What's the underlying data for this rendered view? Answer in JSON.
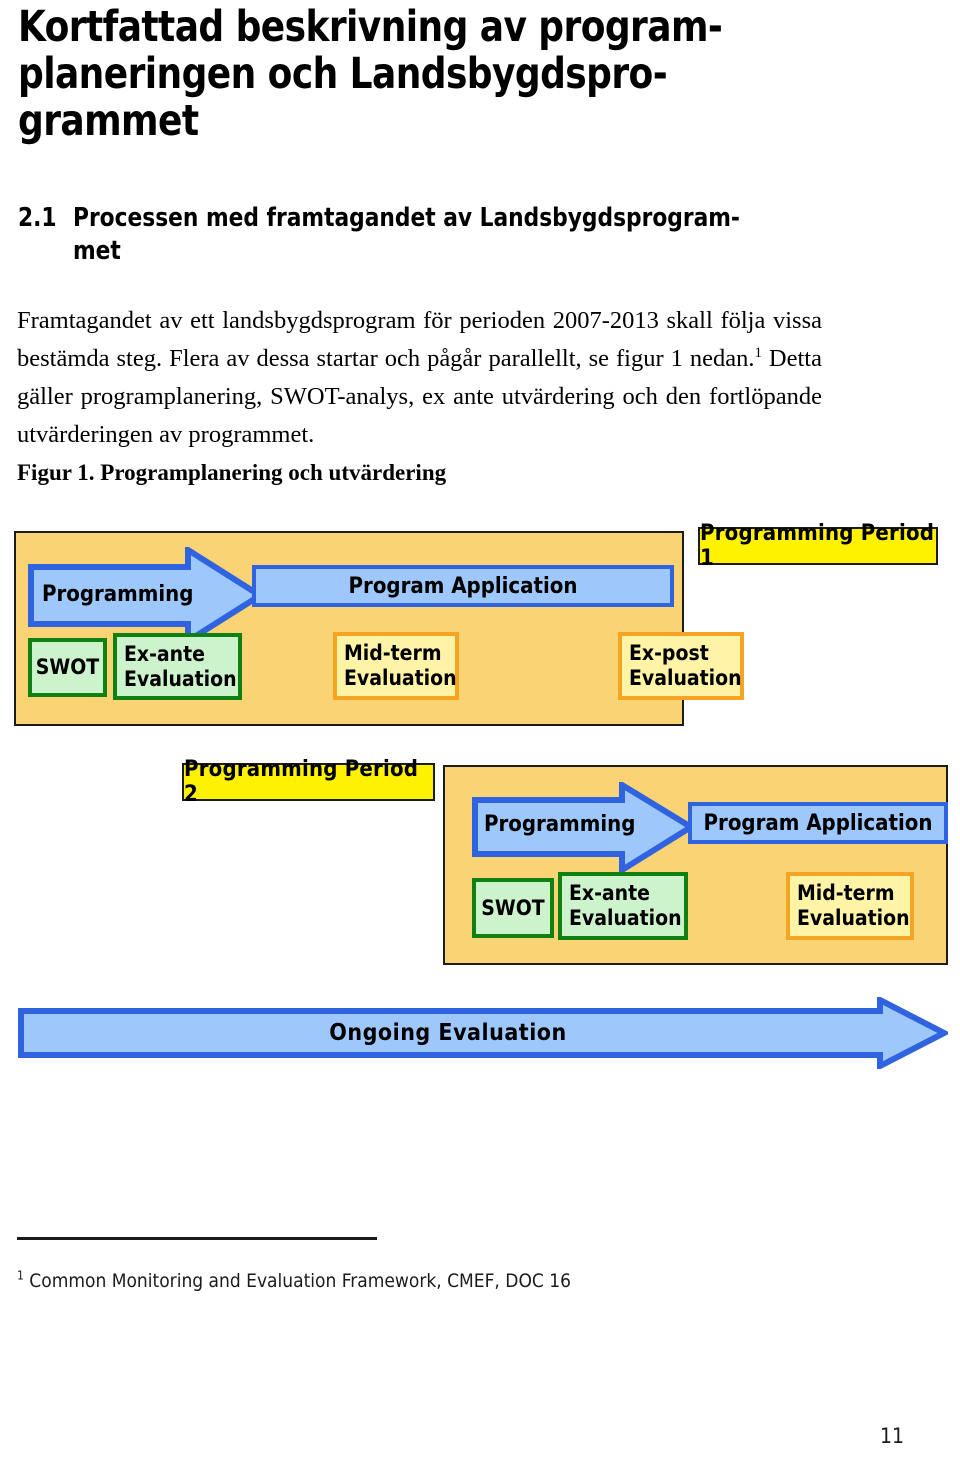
{
  "document": {
    "title": "Kortfattad beskrivning av program-\nplaneringen och Landsbygdspro-\ngrammet",
    "section": {
      "number": "2.1",
      "title": "Processen med framtagandet av Landsbygdsprogram-\nmet"
    },
    "paragraph_part1": "Framtagandet av ett landsbygdsprogram för perioden 2007-2013 skall följa vissa bestämda steg.  Flera av dessa startar och pågår parallellt, se figur 1 nedan.",
    "paragraph_footnote_marker": "1",
    "paragraph_part2": " Detta gäller programplanering, SWOT-analys, ex ante utvärdering och den fortlöpande utvärderingen av programmet.",
    "figure_caption": "Figur 1. Programplanering och utvärdering",
    "footnote_marker": "1",
    "footnote_text": " Common Monitoring and Evaluation Framework, CMEF, DOC 16",
    "page_number": "11"
  },
  "figure": {
    "period1": {
      "tag": "Programming Period 1",
      "programming": "Programming",
      "program_application": "Program Application",
      "swot": "SWOT",
      "ex_ante": "Ex-ante\nEvaluation",
      "mid_term": "Mid-term\nEvaluation",
      "ex_post": "Ex-post\nEvaluation"
    },
    "period2": {
      "tag": "Programming Period 2",
      "programming": "Programming",
      "program_application": "Program Application",
      "swot": "SWOT",
      "ex_ante": "Ex-ante\nEvaluation",
      "mid_term": "Mid-term\nEvaluation"
    },
    "ongoing": "Ongoing  Evaluation",
    "colors": {
      "panel_fill": "#fad474",
      "panel_border": "#1b1b1b",
      "period_tag_fill": "#fff200",
      "arrow_fill": "#9ec8fb",
      "arrow_border": "#2f63e0",
      "green_fill": "#cdf3cd",
      "green_border": "#0f8012",
      "yellow_fill": "#fff3a6",
      "yellow_border": "#f5a523"
    }
  }
}
